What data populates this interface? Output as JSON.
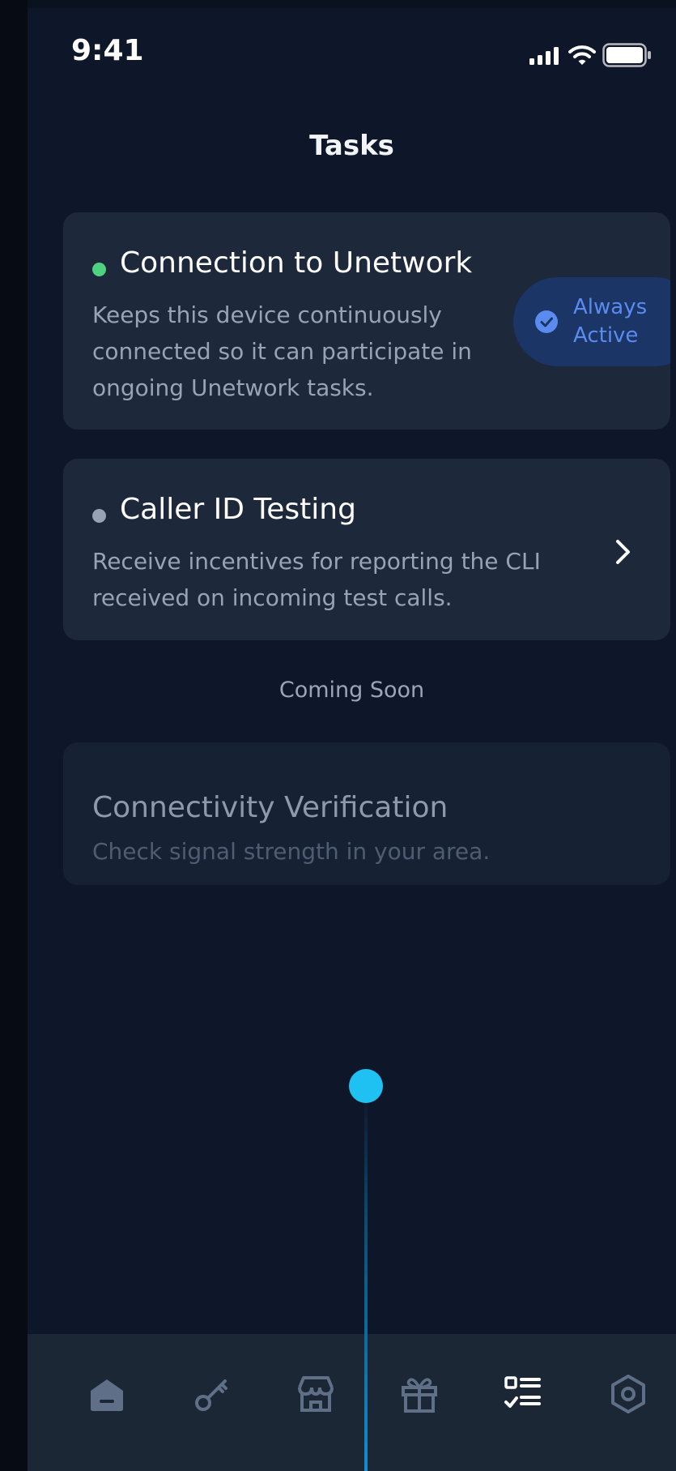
{
  "status_bar": {
    "time": "9:41",
    "icons": [
      "cellular-signal-icon",
      "wifi-icon",
      "battery-icon"
    ]
  },
  "header": {
    "title": "Tasks"
  },
  "tasks": [
    {
      "title": "Connection to Unetwork",
      "description": "Keeps this device continuously connected so it can participate in ongoing Unetwork tasks.",
      "status_dot_color": "#4ed27f",
      "badge": {
        "line1": "Always",
        "line2": "Active",
        "icon": "check-circle-icon"
      }
    },
    {
      "title": "Caller ID Testing",
      "description": "Receive incentives for reporting the CLI received on incoming test calls.",
      "status_dot_color": "#97a3b5",
      "action_icon": "chevron-right-icon"
    }
  ],
  "coming_soon": {
    "label": "Coming Soon",
    "items": [
      {
        "title": "Connectivity Verification",
        "description": "Check signal strength in your area."
      }
    ]
  },
  "tabbar": {
    "items": [
      {
        "icon": "home-icon",
        "active": false
      },
      {
        "icon": "key-icon",
        "active": false
      },
      {
        "icon": "store-icon",
        "active": false
      },
      {
        "icon": "gift-icon",
        "active": false
      },
      {
        "icon": "tasks-icon",
        "active": true
      },
      {
        "icon": "settings-icon",
        "active": false
      }
    ]
  },
  "colors": {
    "background": "#0e1629",
    "card": "#1d283a",
    "accent": "#5a8cef",
    "timeline": "#1fc0f2"
  }
}
